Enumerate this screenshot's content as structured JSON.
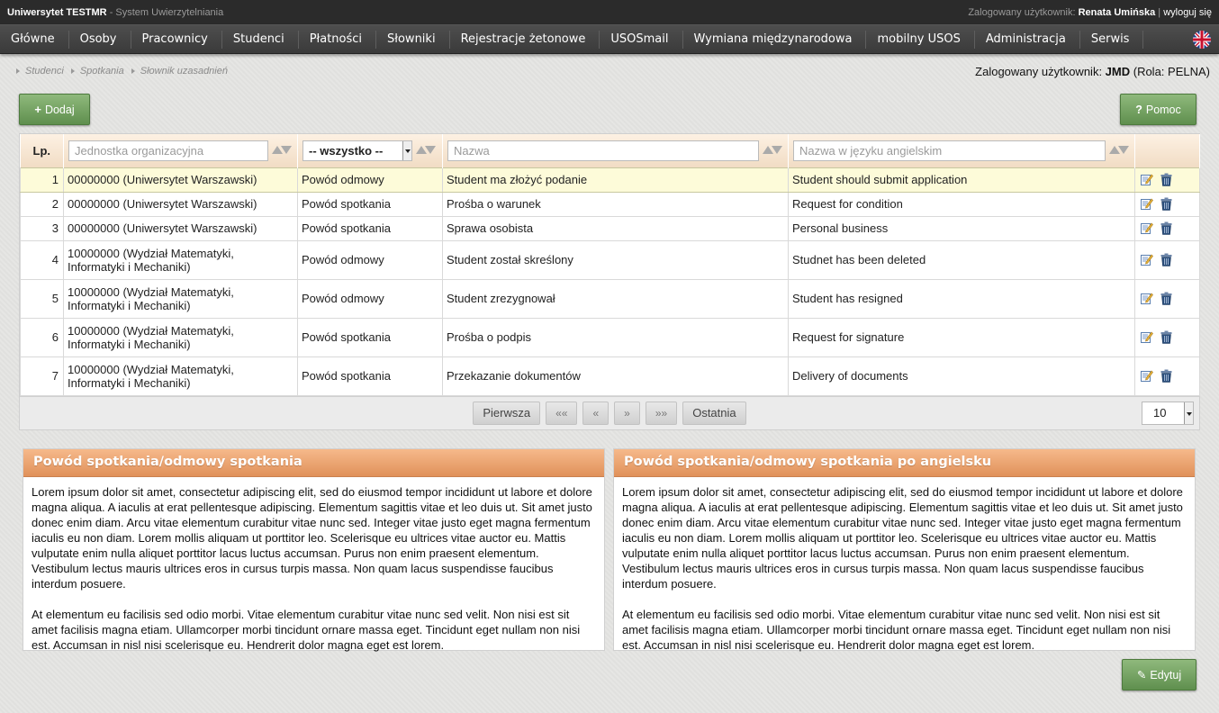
{
  "topbar": {
    "brand": "Uniwersytet TESTMR",
    "system": " - System Uwierzytelniania",
    "user_prefix": "Zalogowany użytkownik: ",
    "user_name": "Renata Umińska",
    "separator": " | ",
    "logout": "wyloguj się"
  },
  "nav": [
    "Główne",
    "Osoby",
    "Pracownicy",
    "Studenci",
    "Płatności",
    "Słowniki",
    "Rejestracje żetonowe",
    "USOSmail",
    "Wymiana międzynarodowa",
    "mobilny USOS",
    "Administracja",
    "Serwis"
  ],
  "breadcrumb": [
    "Studenci",
    "Spotkania",
    "Słownik uzasadnień"
  ],
  "login_info": {
    "prefix": "Zalogowany użytkownik: ",
    "user": "JMD",
    "role": " (Rola: PELNA)"
  },
  "buttons": {
    "add": "Dodaj",
    "help": "Pomoc",
    "edit": "Edytuj"
  },
  "table": {
    "headers": {
      "lp": "Lp.",
      "unit_placeholder": "Jednostka organizacyjna",
      "type_selected": "-- wszystko --",
      "name_placeholder": "Nazwa",
      "name_en_placeholder": "Nazwa w języku angielskim"
    },
    "rows": [
      {
        "lp": "1",
        "unit": "00000000 (Uniwersytet Warszawski)",
        "type": "Powód odmowy",
        "name": "Student ma złożyć podanie",
        "name_en": "Student should submit application"
      },
      {
        "lp": "2",
        "unit": "00000000 (Uniwersytet Warszawski)",
        "type": "Powód spotkania",
        "name": "Prośba o warunek",
        "name_en": "Request for condition"
      },
      {
        "lp": "3",
        "unit": "00000000 (Uniwersytet Warszawski)",
        "type": "Powód spotkania",
        "name": "Sprawa osobista",
        "name_en": "Personal business"
      },
      {
        "lp": "4",
        "unit": "10000000 (Wydział Matematyki, Informatyki i Mechaniki)",
        "type": "Powód odmowy",
        "name": "Student został skreślony",
        "name_en": "Studnet has been deleted"
      },
      {
        "lp": "5",
        "unit": "10000000 (Wydział Matematyki, Informatyki i Mechaniki)",
        "type": "Powód odmowy",
        "name": "Student zrezygnował",
        "name_en": "Student has resigned"
      },
      {
        "lp": "6",
        "unit": "10000000 (Wydział Matematyki, Informatyki i Mechaniki)",
        "type": "Powód spotkania",
        "name": "Prośba o podpis",
        "name_en": "Request for signature"
      },
      {
        "lp": "7",
        "unit": "10000000 (Wydział Matematyki, Informatyki i Mechaniki)",
        "type": "Powód spotkania",
        "name": "Przekazanie dokumentów",
        "name_en": "Delivery of documents"
      }
    ]
  },
  "pager": {
    "first": "Pierwsza",
    "prev_many": "««",
    "prev": "«",
    "next": "»",
    "next_many": "»»",
    "last": "Ostatnia",
    "page_size": "10"
  },
  "panels": {
    "left": {
      "title": "Powód spotkania/odmowy spotkania",
      "p1": "Lorem ipsum dolor sit amet, consectetur adipiscing elit, sed do eiusmod tempor incididunt ut labore et dolore magna aliqua. A iaculis at erat pellentesque adipiscing. Elementum sagittis vitae et leo duis ut. Sit amet justo donec enim diam. Arcu vitae elementum curabitur vitae nunc sed. Integer vitae justo eget magna fermentum iaculis eu non diam. Lorem mollis aliquam ut porttitor leo. Scelerisque eu ultrices vitae auctor eu. Mattis vulputate enim nulla aliquet porttitor lacus luctus accumsan. Purus non enim praesent elementum. Vestibulum lectus mauris ultrices eros in cursus turpis massa. Non quam lacus suspendisse faucibus interdum posuere.",
      "p2": "At elementum eu facilisis sed odio morbi. Vitae elementum curabitur vitae nunc sed velit. Non nisi est sit amet facilisis magna etiam. Ullamcorper morbi tincidunt ornare massa eget. Tincidunt eget nullam non nisi est. Accumsan in nisl nisi scelerisque eu. Hendrerit dolor magna eget est lorem."
    },
    "right": {
      "title": "Powód spotkania/odmowy spotkania po angielsku",
      "p1": "Lorem ipsum dolor sit amet, consectetur adipiscing elit, sed do eiusmod tempor incididunt ut labore et dolore magna aliqua. A iaculis at erat pellentesque adipiscing. Elementum sagittis vitae et leo duis ut. Sit amet justo donec enim diam. Arcu vitae elementum curabitur vitae nunc sed. Integer vitae justo eget magna fermentum iaculis eu non diam. Lorem mollis aliquam ut porttitor leo. Scelerisque eu ultrices vitae auctor eu. Mattis vulputate enim nulla aliquet porttitor lacus luctus accumsan. Purus non enim praesent elementum. Vestibulum lectus mauris ultrices eros in cursus turpis massa. Non quam lacus suspendisse faucibus interdum posuere.",
      "p2": "At elementum eu facilisis sed odio morbi. Vitae elementum curabitur vitae nunc sed velit. Non nisi est sit amet facilisis magna etiam. Ullamcorper morbi tincidunt ornare massa eget. Tincidunt eget nullam non nisi est. Accumsan in nisl nisi scelerisque eu. Hendrerit dolor magna eget est lorem."
    }
  }
}
